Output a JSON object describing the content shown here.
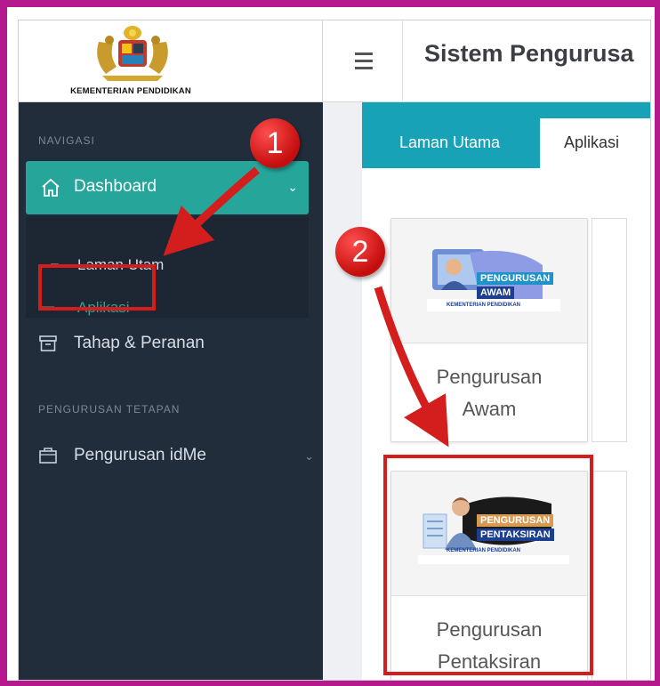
{
  "logo": {
    "ministry": "KEMENTERIAN PENDIDIKAN"
  },
  "header": {
    "title": "Sistem Pengurusa"
  },
  "sidebar": {
    "section_navigation": "NAVIGASI",
    "dashboard_label": "Dashboard",
    "submenu": [
      {
        "label": "Laman Utam"
      },
      {
        "label": "Aplikasi"
      }
    ],
    "tahap_label": "Tahap & Peranan",
    "section_settings": "PENGURUSAN TETAPAN",
    "idme_label": "Pengurusan idMe"
  },
  "tabs": [
    {
      "label": "Laman Utama"
    },
    {
      "label": "Aplikasi"
    }
  ],
  "cards": [
    {
      "title_line1": "Pengurusan",
      "title_line2": "Awam",
      "badge_line1": "PENGURUSAN",
      "badge_line2": "AWAM",
      "badge_footer": "KEMENTERIAN PENDIDIKAN"
    },
    {
      "title_line1": "Pengurusan",
      "title_line2": "Pentaksiran",
      "badge_line1": "PENGURUSAN",
      "badge_line2": "PENTAKSIRAN",
      "badge_footer": "KEMENTERIAN PENDIDIKAN"
    }
  ],
  "annotations": {
    "step1": "1",
    "step2": "2"
  },
  "colors": {
    "frame": "#b6188e",
    "accent_teal": "#26a69a",
    "tab_strip": "#17a2b8",
    "sidebar": "#222d3c",
    "annotation_red": "#d41d1d"
  }
}
